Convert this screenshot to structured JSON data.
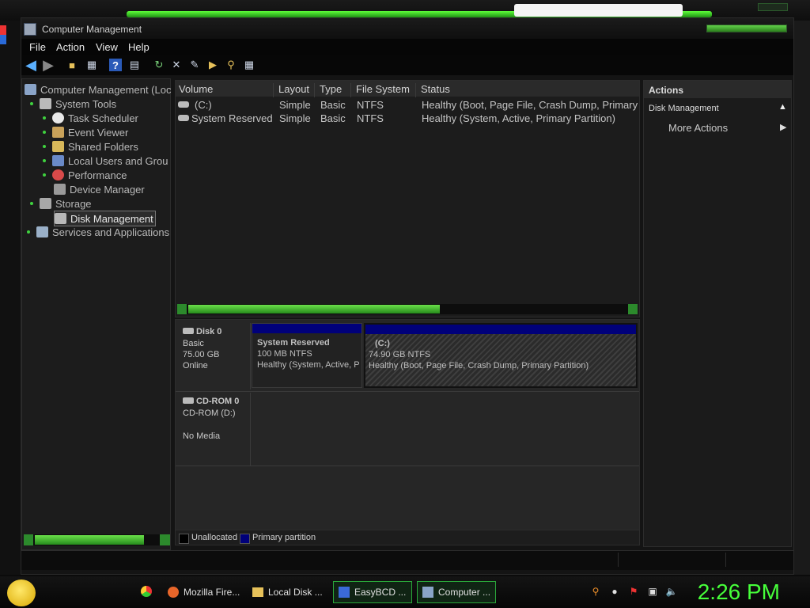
{
  "window": {
    "title": "Computer Management"
  },
  "menu": [
    "File",
    "Action",
    "View",
    "Help"
  ],
  "toolbar": [
    "back-arrow-icon",
    "forward-arrow-icon",
    "folder-up-icon",
    "console-tree-icon",
    "help-icon",
    "properties-icon",
    "refresh-icon",
    "delete-icon",
    "wizard-icon",
    "open-icon",
    "search-icon",
    "export-icon"
  ],
  "tree": [
    {
      "label": "Computer Management (Loc",
      "level": 0,
      "icon": "computer-icon"
    },
    {
      "label": "System Tools",
      "level": 1,
      "icon": "tools-icon"
    },
    {
      "label": "Task Scheduler",
      "level": 2,
      "icon": "clock-icon"
    },
    {
      "label": "Event Viewer",
      "level": 2,
      "icon": "event-viewer-icon"
    },
    {
      "label": "Shared Folders",
      "level": 2,
      "icon": "shared-folders-icon"
    },
    {
      "label": "Local Users and Grou",
      "level": 2,
      "icon": "users-icon"
    },
    {
      "label": "Performance",
      "level": 2,
      "icon": "performance-icon"
    },
    {
      "label": "Device Manager",
      "level": 2,
      "icon": "device-manager-icon"
    },
    {
      "label": "Storage",
      "level": 1,
      "icon": "storage-icon"
    },
    {
      "label": "Disk Management",
      "level": 2,
      "icon": "disk-management-icon",
      "selected": true
    },
    {
      "label": "Services and Applications",
      "level": 1,
      "icon": "services-icon"
    }
  ],
  "volumes": {
    "columns": [
      "Volume",
      "Layout",
      "Type",
      "File System",
      "Status"
    ],
    "rows": [
      {
        "volume": "(C:)",
        "layout": "Simple",
        "type": "Basic",
        "fs": "NTFS",
        "status": "Healthy (Boot, Page File, Crash Dump, Primary"
      },
      {
        "volume": "System Reserved",
        "layout": "Simple",
        "type": "Basic",
        "fs": "NTFS",
        "status": "Healthy (System, Active, Primary Partition)"
      }
    ]
  },
  "disk0": {
    "name": "Disk 0",
    "kind": "Basic",
    "size": "75.00 GB",
    "state": "Online",
    "partitions": [
      {
        "title": "System Reserved",
        "size": "100 MB NTFS",
        "status": "Healthy (System, Active, P"
      },
      {
        "title": "(C:)",
        "size": "74.90 GB NTFS",
        "status": "Healthy (Boot, Page File, Crash Dump, Primary Partition)"
      }
    ]
  },
  "cdrom": {
    "name": "CD-ROM 0",
    "drive": "CD-ROM (D:)",
    "state": "No Media"
  },
  "legend": {
    "unallocated": "Unallocated",
    "primary": "Primary partition"
  },
  "actions": {
    "header": "Actions",
    "section": "Disk Management",
    "more": "More Actions"
  },
  "taskbar": {
    "items": [
      {
        "label": "Mozilla Fire...",
        "icon": "firefox-icon"
      },
      {
        "label": "Local Disk ...",
        "icon": "folder-icon"
      },
      {
        "label": "EasyBCD ...",
        "icon": "easybcd-icon",
        "active": true
      },
      {
        "label": "Computer ...",
        "icon": "computer-icon",
        "active": true
      }
    ],
    "clock": "2:26 PM"
  },
  "colors": {
    "accent": "#46ff3a",
    "primary_partition": "#00007a",
    "background": "#141414"
  }
}
